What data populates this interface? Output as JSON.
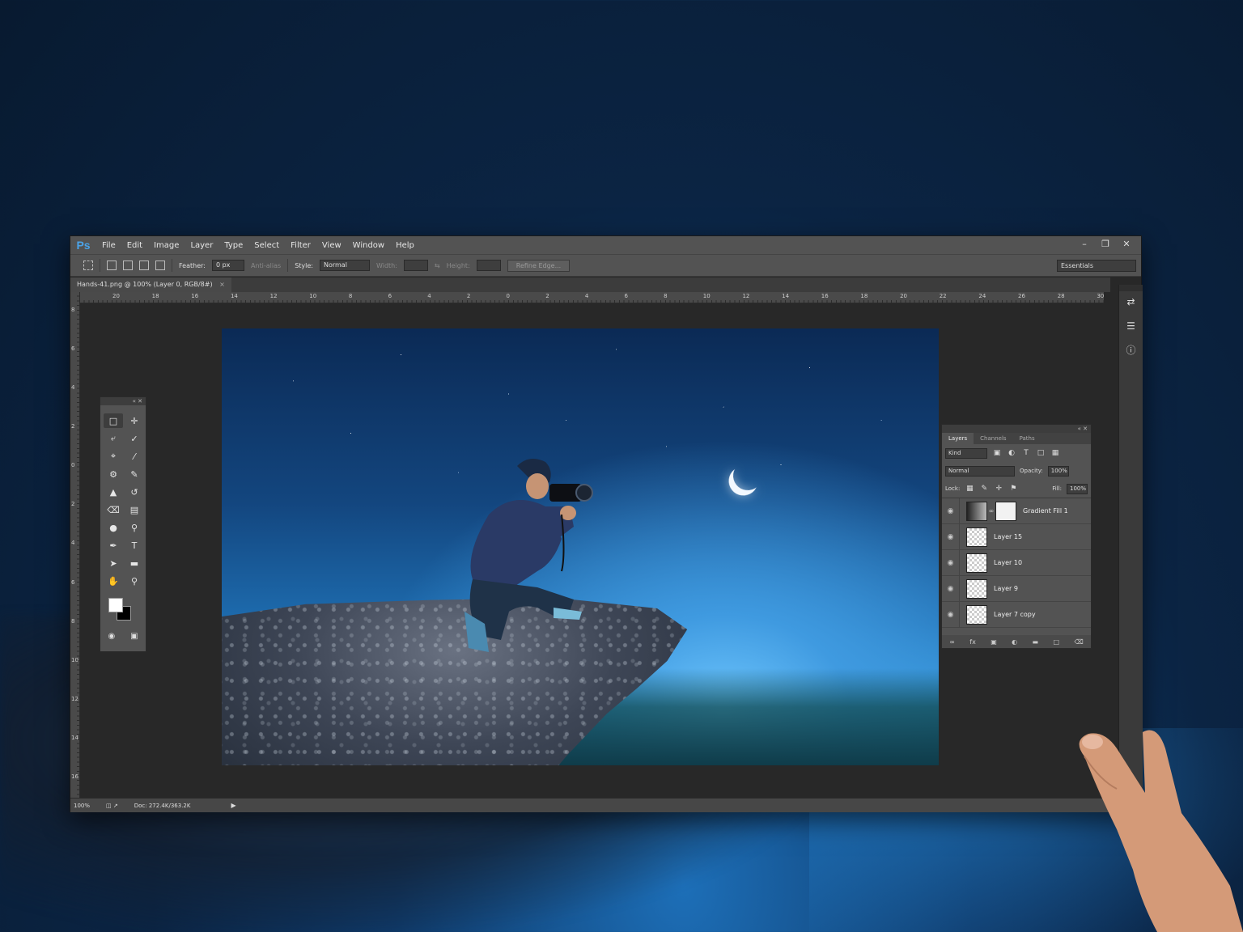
{
  "menubar": {
    "logo": "Ps",
    "items": [
      "File",
      "Edit",
      "Image",
      "Layer",
      "Type",
      "Select",
      "Filter",
      "View",
      "Window",
      "Help"
    ]
  },
  "options": {
    "feather_label": "Feather:",
    "feather_value": "0 px",
    "antialias_label": "Anti-alias",
    "style_label": "Style:",
    "style_value": "Normal",
    "width_label": "Width:",
    "height_label": "Height:",
    "refine_edge_label": "Refine Edge...",
    "workspace_value": "Essentials"
  },
  "document": {
    "tab_title": "Hands-41.png @ 100% (Layer 0, RGB/8#)",
    "tab_close": "×"
  },
  "ruler": {
    "top_labels": [
      "20",
      "18",
      "16",
      "14",
      "12",
      "10",
      "8",
      "6",
      "4",
      "2",
      "0",
      "2",
      "4",
      "6",
      "8",
      "10",
      "12",
      "14",
      "16",
      "18",
      "20",
      "22",
      "24",
      "26",
      "28",
      "30"
    ],
    "left_labels": [
      "8",
      "6",
      "4",
      "2",
      "0",
      "2",
      "4",
      "6",
      "8",
      "10",
      "12",
      "14",
      "16"
    ]
  },
  "layers_panel": {
    "tabs": [
      "Layers",
      "Channels",
      "Paths"
    ],
    "kind_value": "Kind",
    "blend_mode": "Normal",
    "opacity_label": "Opacity:",
    "opacity_value": "100%",
    "lock_label": "Lock:",
    "fill_label": "Fill:",
    "fill_value": "100%",
    "layers": [
      {
        "name": "Gradient Fill 1",
        "thumb": "gradient",
        "has_mask": true
      },
      {
        "name": "Layer 15",
        "thumb": "transparent",
        "has_mask": false
      },
      {
        "name": "Layer 10",
        "thumb": "transparent",
        "has_mask": false
      },
      {
        "name": "Layer 9",
        "thumb": "transparent",
        "has_mask": false
      },
      {
        "name": "Layer 7 copy",
        "thumb": "transparent",
        "has_mask": false
      }
    ],
    "footer_icons": [
      "link-icon",
      "fx-icon",
      "mask-icon",
      "adjustment-icon",
      "folder-icon",
      "new-layer-icon",
      "trash-icon"
    ]
  },
  "statusbar": {
    "zoom": "100%",
    "doc_size": "Doc: 272.4K/363.2K"
  },
  "colors": {
    "foreground": "#ffffff",
    "background": "#000000",
    "ps_accent": "#4aa3e8"
  }
}
